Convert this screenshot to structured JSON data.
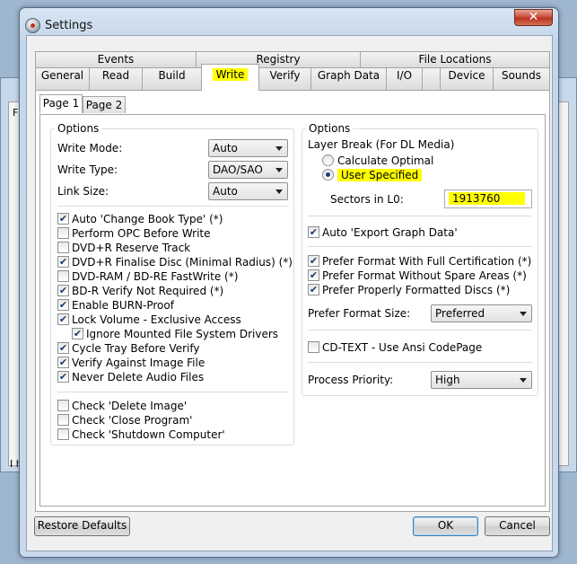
{
  "window": {
    "title": "Settings",
    "close_glyph": "✕"
  },
  "background_window": {
    "left_text_1": "F",
    "left_text_2": "I h"
  },
  "tabs_row1": [
    "Events",
    "Registry",
    "File Locations"
  ],
  "tabs_row2": [
    "General",
    "Read",
    "Build",
    "Write",
    "Verify",
    "Graph Data",
    "I/O",
    "Device",
    "Sounds"
  ],
  "active_tab": "Write",
  "subtabs": [
    "Page 1",
    "Page 2"
  ],
  "left": {
    "legend": "Options",
    "write_mode": {
      "label": "Write Mode:",
      "value": "Auto"
    },
    "write_type": {
      "label": "Write Type:",
      "value": "DAO/SAO"
    },
    "link_size": {
      "label": "Link Size:",
      "value": "Auto"
    },
    "checks": [
      {
        "label": "Auto 'Change Book Type' (*)",
        "checked": true
      },
      {
        "label": "Perform OPC Before Write",
        "checked": false
      },
      {
        "label": "DVD+R Reserve Track",
        "checked": false
      },
      {
        "label": "DVD+R Finalise Disc (Minimal Radius) (*)",
        "checked": true
      },
      {
        "label": "DVD-RAM / BD-RE FastWrite (*)",
        "checked": false
      },
      {
        "label": "BD-R Verify Not Required (*)",
        "checked": true
      },
      {
        "label": "Enable BURN-Proof",
        "checked": true
      },
      {
        "label": "Lock Volume - Exclusive Access",
        "checked": true
      },
      {
        "label": "Ignore Mounted File System Drivers",
        "checked": true
      },
      {
        "label": "Cycle Tray Before Verify",
        "checked": true
      },
      {
        "label": "Verify Against Image File",
        "checked": true
      },
      {
        "label": "Never Delete Audio Files",
        "checked": true
      }
    ],
    "checks2": [
      {
        "label": "Check 'Delete Image'",
        "checked": false
      },
      {
        "label": "Check 'Close Program'",
        "checked": false
      },
      {
        "label": "Check 'Shutdown Computer'",
        "checked": false
      }
    ]
  },
  "right": {
    "legend": "Options",
    "layer_break_label": "Layer Break (For DL Media)",
    "radio_calc": "Calculate Optimal",
    "radio_user": "User Specified",
    "sectors_label": "Sectors in L0:",
    "sectors_value": "1913760",
    "auto_export": {
      "label": "Auto 'Export Graph Data'",
      "checked": true
    },
    "checks": [
      {
        "label": "Prefer Format With Full Certification (*)",
        "checked": true
      },
      {
        "label": "Prefer Format Without Spare Areas (*)",
        "checked": true
      },
      {
        "label": "Prefer Properly Formatted Discs (*)",
        "checked": true
      }
    ],
    "prefer_format_size": {
      "label": "Prefer Format Size:",
      "value": "Preferred"
    },
    "cdtext": {
      "label": "CD-TEXT - Use Ansi CodePage",
      "checked": false
    },
    "process_priority": {
      "label": "Process Priority:",
      "value": "High"
    }
  },
  "buttons": {
    "restore": "Restore Defaults",
    "ok": "OK",
    "cancel": "Cancel"
  },
  "check_glyph": "✔",
  "highlight_color": "#ffff00"
}
